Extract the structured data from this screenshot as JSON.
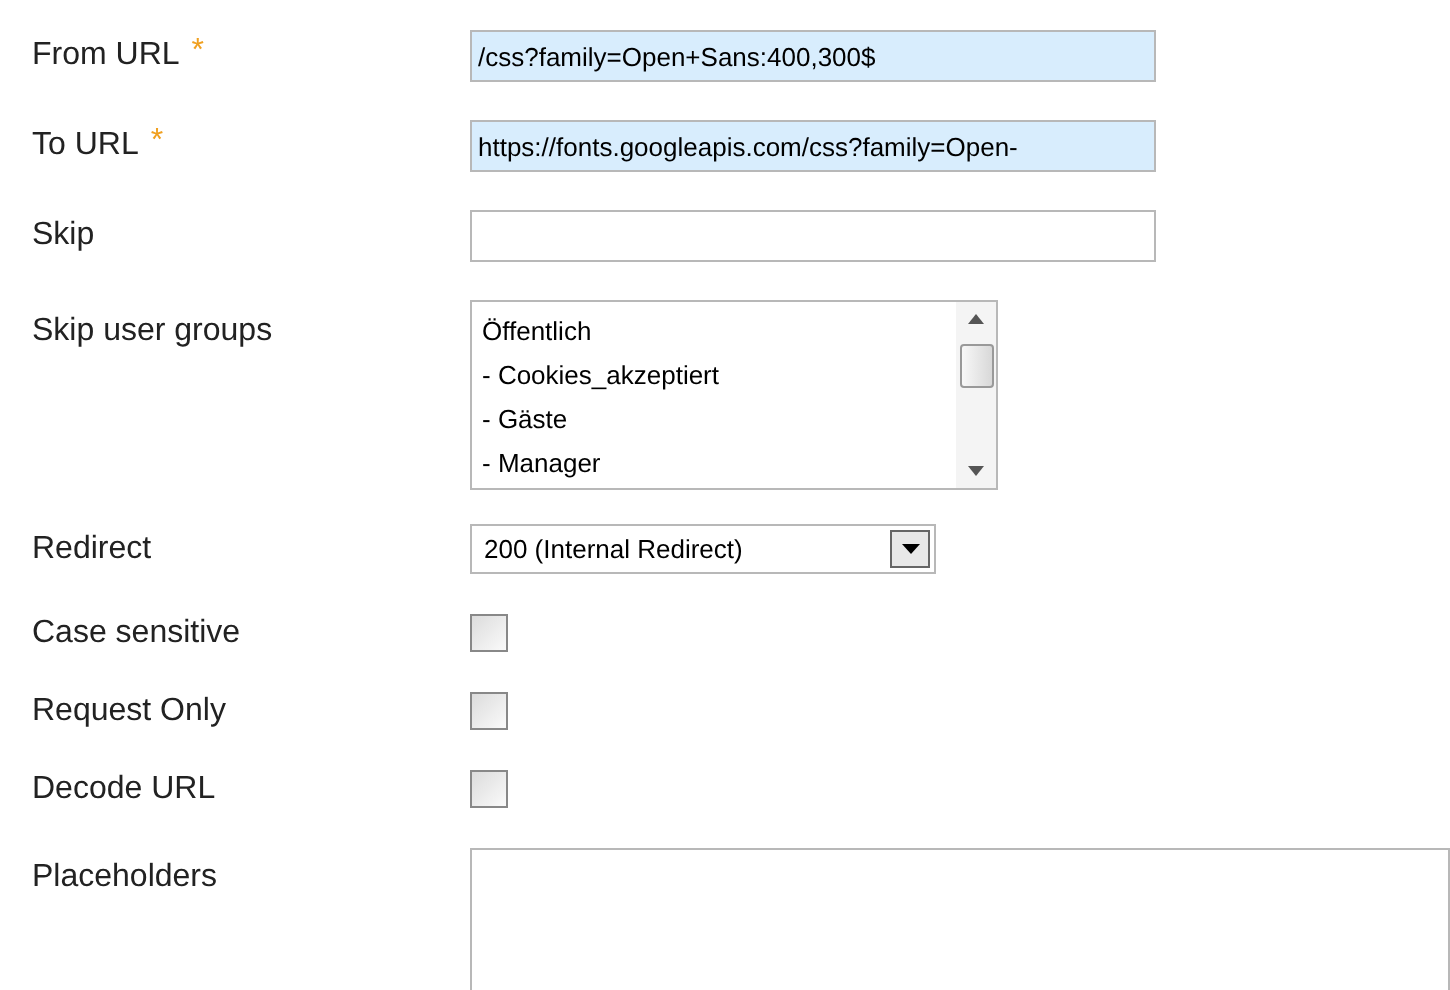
{
  "fields": [
    {
      "kind": "text",
      "label": "From URL",
      "required_mark": "*",
      "value": "/css?family=Open+Sans:400,300$",
      "highlighted": true
    },
    {
      "kind": "text",
      "label": "To URL",
      "required_mark": "*",
      "value": "https://fonts.googleapis.com/css?family=Open-",
      "highlighted": true
    },
    {
      "kind": "text",
      "label": "Skip",
      "highlighted": false
    },
    {
      "kind": "listbox",
      "label": "Skip user groups",
      "options": [
        "Öffentlich",
        "- Cookies_akzeptiert",
        "- Gäste",
        "- Manager"
      ]
    },
    {
      "kind": "select",
      "label": "Redirect",
      "value": "200 (Internal Redirect)"
    },
    {
      "kind": "checkbox",
      "label": "Case sensitive",
      "checked": false
    },
    {
      "kind": "checkbox",
      "label": "Request Only",
      "checked": false
    },
    {
      "kind": "checkbox",
      "label": "Decode URL",
      "checked": false
    },
    {
      "kind": "textarea",
      "label": "Placeholders"
    }
  ]
}
